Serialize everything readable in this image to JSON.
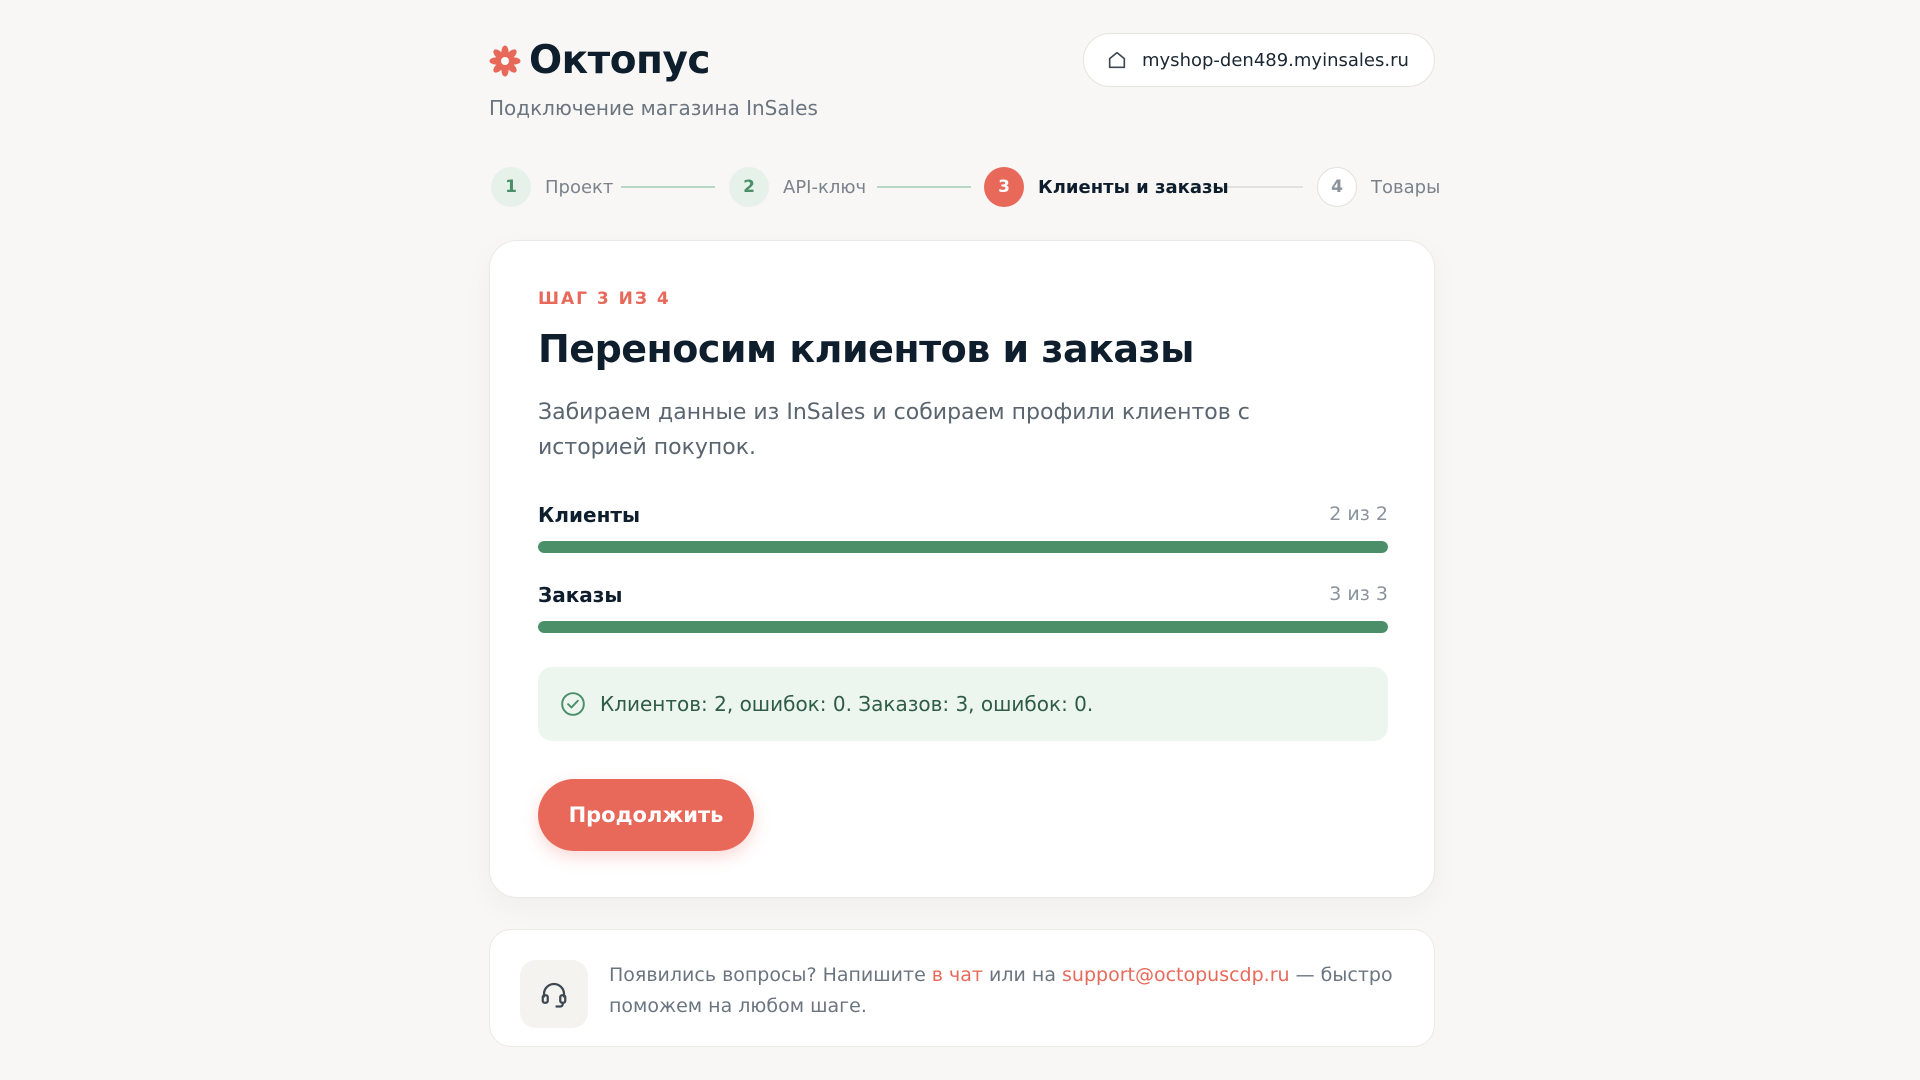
{
  "brand": {
    "name": "Октопус",
    "subtitle": "Подключение магазина InSales",
    "accent_color": "#e8695a",
    "success_color": "#4a8f68"
  },
  "shop": {
    "icon": "home-icon",
    "domain": "myshop-den489.myinsales.ru"
  },
  "stepper": {
    "steps": [
      {
        "num": "1",
        "label": "Проект",
        "state": "done"
      },
      {
        "num": "2",
        "label": "API-ключ",
        "state": "done"
      },
      {
        "num": "3",
        "label": "Клиенты и заказы",
        "state": "active"
      },
      {
        "num": "4",
        "label": "Товары",
        "state": "todo"
      }
    ]
  },
  "card": {
    "eyebrow": "ШАГ 3 ИЗ 4",
    "title": "Переносим клиентов и заказы",
    "description": "Забираем данные из InSales и собираем профили клиентов с историей покупок.",
    "progress": [
      {
        "label": "Клиенты",
        "count": "2 из 2",
        "done": 2,
        "total": 2
      },
      {
        "label": "Заказы",
        "count": "3 из 3",
        "done": 3,
        "total": 3
      }
    ],
    "status": {
      "icon": "check-circle-icon",
      "text": "Клиентов: 2, ошибок: 0. Заказов: 3, ошибок: 0."
    },
    "continue_label": "Продолжить"
  },
  "help": {
    "icon": "headset-icon",
    "text_before": "Появились вопросы? Напишите ",
    "chat_link": "в чат",
    "text_middle": " или на ",
    "email_link": "support@octopuscdp.ru",
    "text_after": " — быстро поможем на любом шаге."
  }
}
